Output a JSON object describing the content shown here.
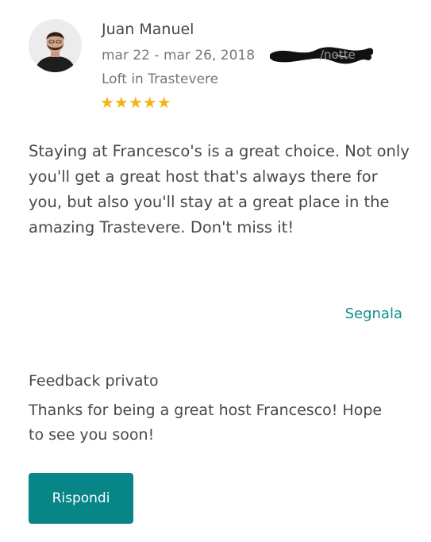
{
  "review": {
    "reviewer_name": "Juan Manuel",
    "dates": "mar 22 - mar 26, 2018",
    "price_suffix": "/notte",
    "listing": "Loft in Trastevere",
    "rating_stars": 5,
    "rating_display": "★★★★★",
    "text": "Staying at Francesco's is a great choice. Not only you'll get a great host that's always there for you, but also you'll stay at a great place in the amazing Trastevere. Don't miss it!",
    "report_label": "Segnala"
  },
  "private_feedback": {
    "title": "Feedback privato",
    "text": "Thanks for being a great host Francesco! Hope to see you soon!"
  },
  "actions": {
    "reply_label": "Rispondi"
  },
  "colors": {
    "accent": "#078587",
    "link": "#0f8f8f",
    "stars": "#f5b312",
    "text": "#484848",
    "muted": "#767676"
  }
}
